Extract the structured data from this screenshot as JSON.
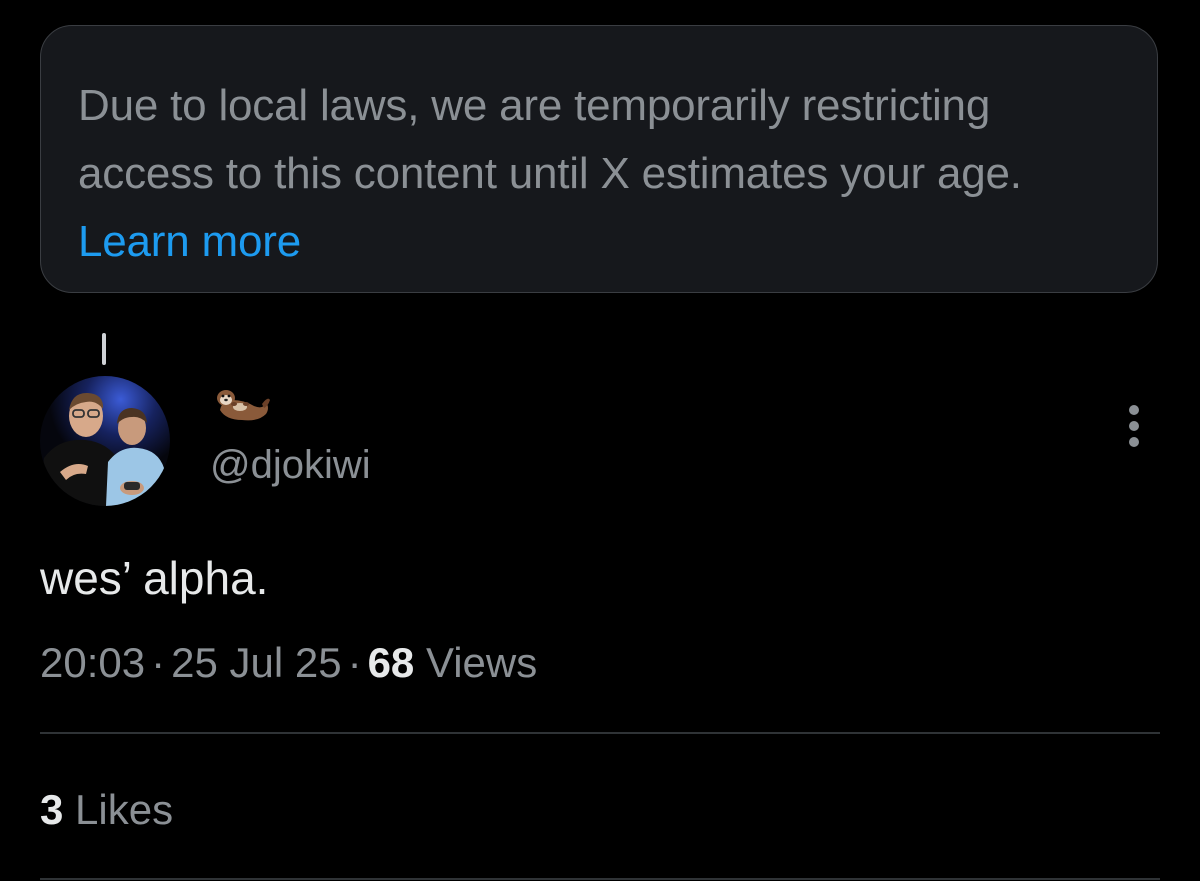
{
  "notice": {
    "message": "Due to local laws, we are temporarily restricting access to this content until X estimates your age.",
    "link_label": "Learn more",
    "link_color": "#1d9bf0"
  },
  "post": {
    "author": {
      "display_name_icon": "otter-emoji-icon",
      "handle": "@djokiwi",
      "avatar_icon": "profile-photo-avatar"
    },
    "menu_icon": "more-options-icon",
    "text": "wes’ alpha.",
    "time": "20:03",
    "separator": "·",
    "date": "25 Jul 25",
    "views_count": "68",
    "views_label": "Views"
  },
  "engagement": {
    "likes_count": "3",
    "likes_label": "Likes"
  },
  "colors": {
    "background": "#000000",
    "primary_text": "#e7e9ea",
    "secondary_text": "#8b9095",
    "divider": "#2f3336",
    "notice_background": "#16181c"
  }
}
